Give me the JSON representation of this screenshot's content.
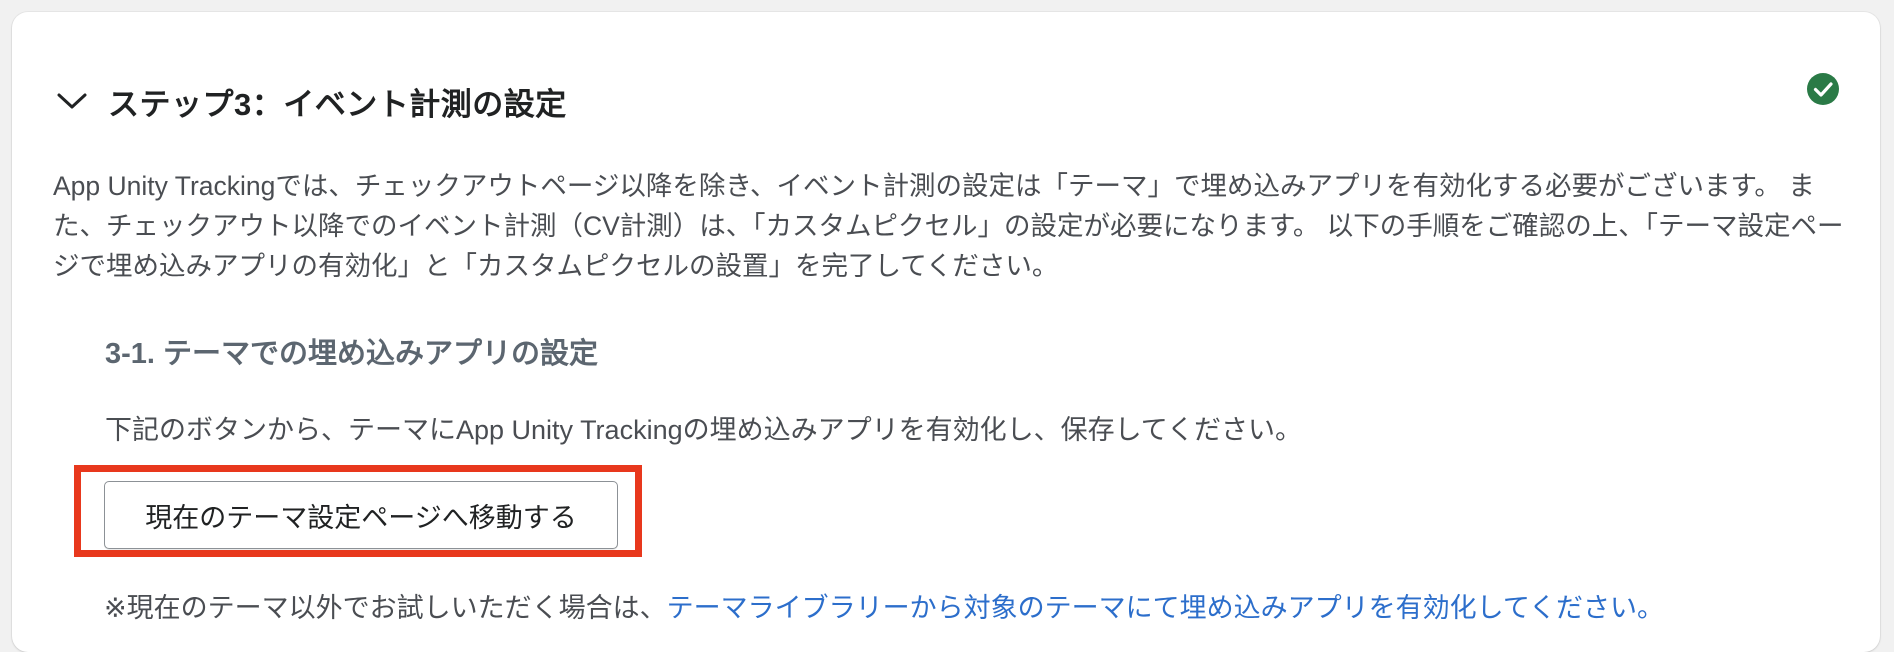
{
  "step": {
    "title": "ステップ3：イベント計測の設定",
    "collapse_icon": "chevron-down-icon",
    "status_icon": "check-circle-icon",
    "status_color": "#2a7a46",
    "description": "App Unity Trackingでは、チェックアウトページ以降を除き、イベント計測の設定は「テーマ」で埋め込みアプリを有効化する必要がございます。 また、チェックアウト以降でのイベント計測（CV計測）は、「カスタムピクセル」の設定が必要になります。 以下の手順をご確認の上、「テーマ設定ページで埋め込みアプリの有効化」と「カスタムピクセルの設置」を完了してください。"
  },
  "section": {
    "title": "3-1. テーマでの埋め込みアプリの設定",
    "instruction": "下記のボタンから、テーマにApp Unity Trackingの埋め込みアプリを有効化し、保存してください。",
    "button_label": "現在のテーマ設定ページへ移動する",
    "highlight_color": "#e8381d",
    "note_prefix": "※現在のテーマ以外でお試しいただく場合は、",
    "note_link": "テーマライブラリーから対象のテーマにて埋め込みアプリを有効化してください。",
    "link_color": "#2c6ecb"
  }
}
